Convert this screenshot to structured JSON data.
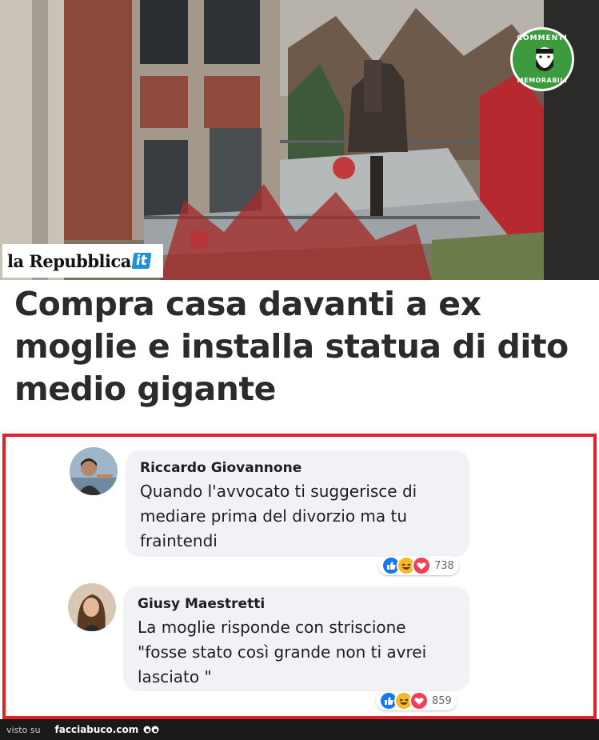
{
  "source_logo": {
    "brand": "la Repubblica",
    "tld": "it"
  },
  "badge": {
    "top": "COMMENTI",
    "bottom": "MEMORABILI"
  },
  "headline": "Compra casa davanti a ex moglie e installa statua di dito medio gigante",
  "comments": [
    {
      "author": "Riccardo Giovannone",
      "text": "Quando l'avvocato ti suggerisce di mediare prima del divorzio ma tu fraintendi",
      "reactions": [
        "like",
        "haha",
        "love"
      ],
      "count": "738"
    },
    {
      "author": "Giusy Maestretti",
      "text": "La moglie risponde con striscione \"fosse stato così grande non ti avrei lasciato \"",
      "reactions": [
        "like",
        "haha",
        "love"
      ],
      "count": "859"
    }
  ],
  "footer": {
    "prefix": "visto su",
    "site": "facciabuco.com"
  },
  "colors": {
    "frame": "#e2202a",
    "badge": "#3c9a3f",
    "like": "#1877f2",
    "haha": "#f7b928",
    "love": "#f33e58"
  }
}
